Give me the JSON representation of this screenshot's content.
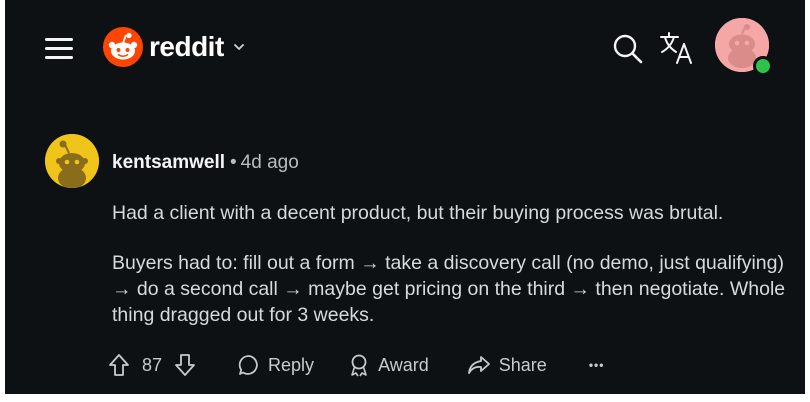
{
  "header": {
    "logo_text": "reddit",
    "icons": [
      "menu-icon",
      "reddit-logo-icon",
      "chevron-down-icon",
      "search-icon",
      "translate-icon",
      "user-avatar"
    ]
  },
  "comment": {
    "author": "kentsamwell",
    "separator": "•",
    "time": "4d ago",
    "paragraphs": [
      "Had a client with a decent product, but their buying process was brutal.",
      "Buyers had to: fill out a form → take a discovery call (no demo, just qualifying) → do a second call → maybe get pricing on the third → then negotiate. Whole thing dragged out for 3 weeks."
    ],
    "votes": "87",
    "actions": {
      "reply": "Reply",
      "award": "Award",
      "share": "Share",
      "more": "•••"
    }
  },
  "colors": {
    "background": "#0e1113",
    "brand": "#ff4500",
    "author_avatar": "#f0c419",
    "user_avatar": "#f4a7a5",
    "online": "#2ec24a"
  }
}
